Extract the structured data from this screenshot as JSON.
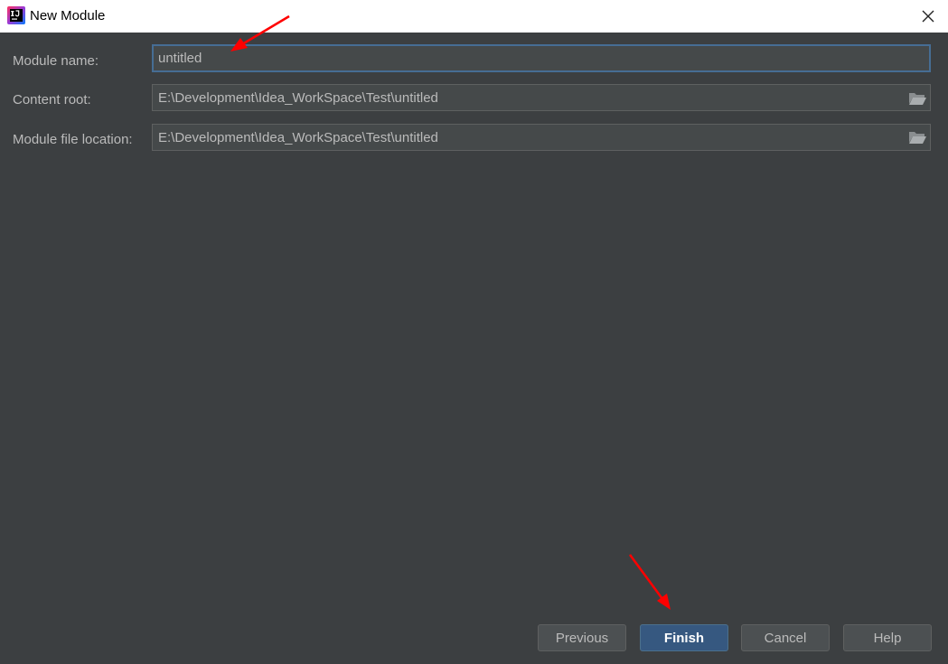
{
  "window": {
    "title": "New Module",
    "icon": "intellij-idea-icon"
  },
  "form": {
    "module_name": {
      "label": "Module name:",
      "value": "untitled"
    },
    "content_root": {
      "label": "Content root:",
      "value": "E:\\Development\\Idea_WorkSpace\\Test\\untitled"
    },
    "module_file_location": {
      "label": "Module file location:",
      "value": "E:\\Development\\Idea_WorkSpace\\Test\\untitled"
    }
  },
  "buttons": {
    "previous": "Previous",
    "finish": "Finish",
    "cancel": "Cancel",
    "help": "Help"
  },
  "colors": {
    "background": "#3c3f41",
    "field_background": "#45494a",
    "focus_border": "#466d94",
    "primary_button": "#365880",
    "annotation_arrow": "#ff0000"
  }
}
